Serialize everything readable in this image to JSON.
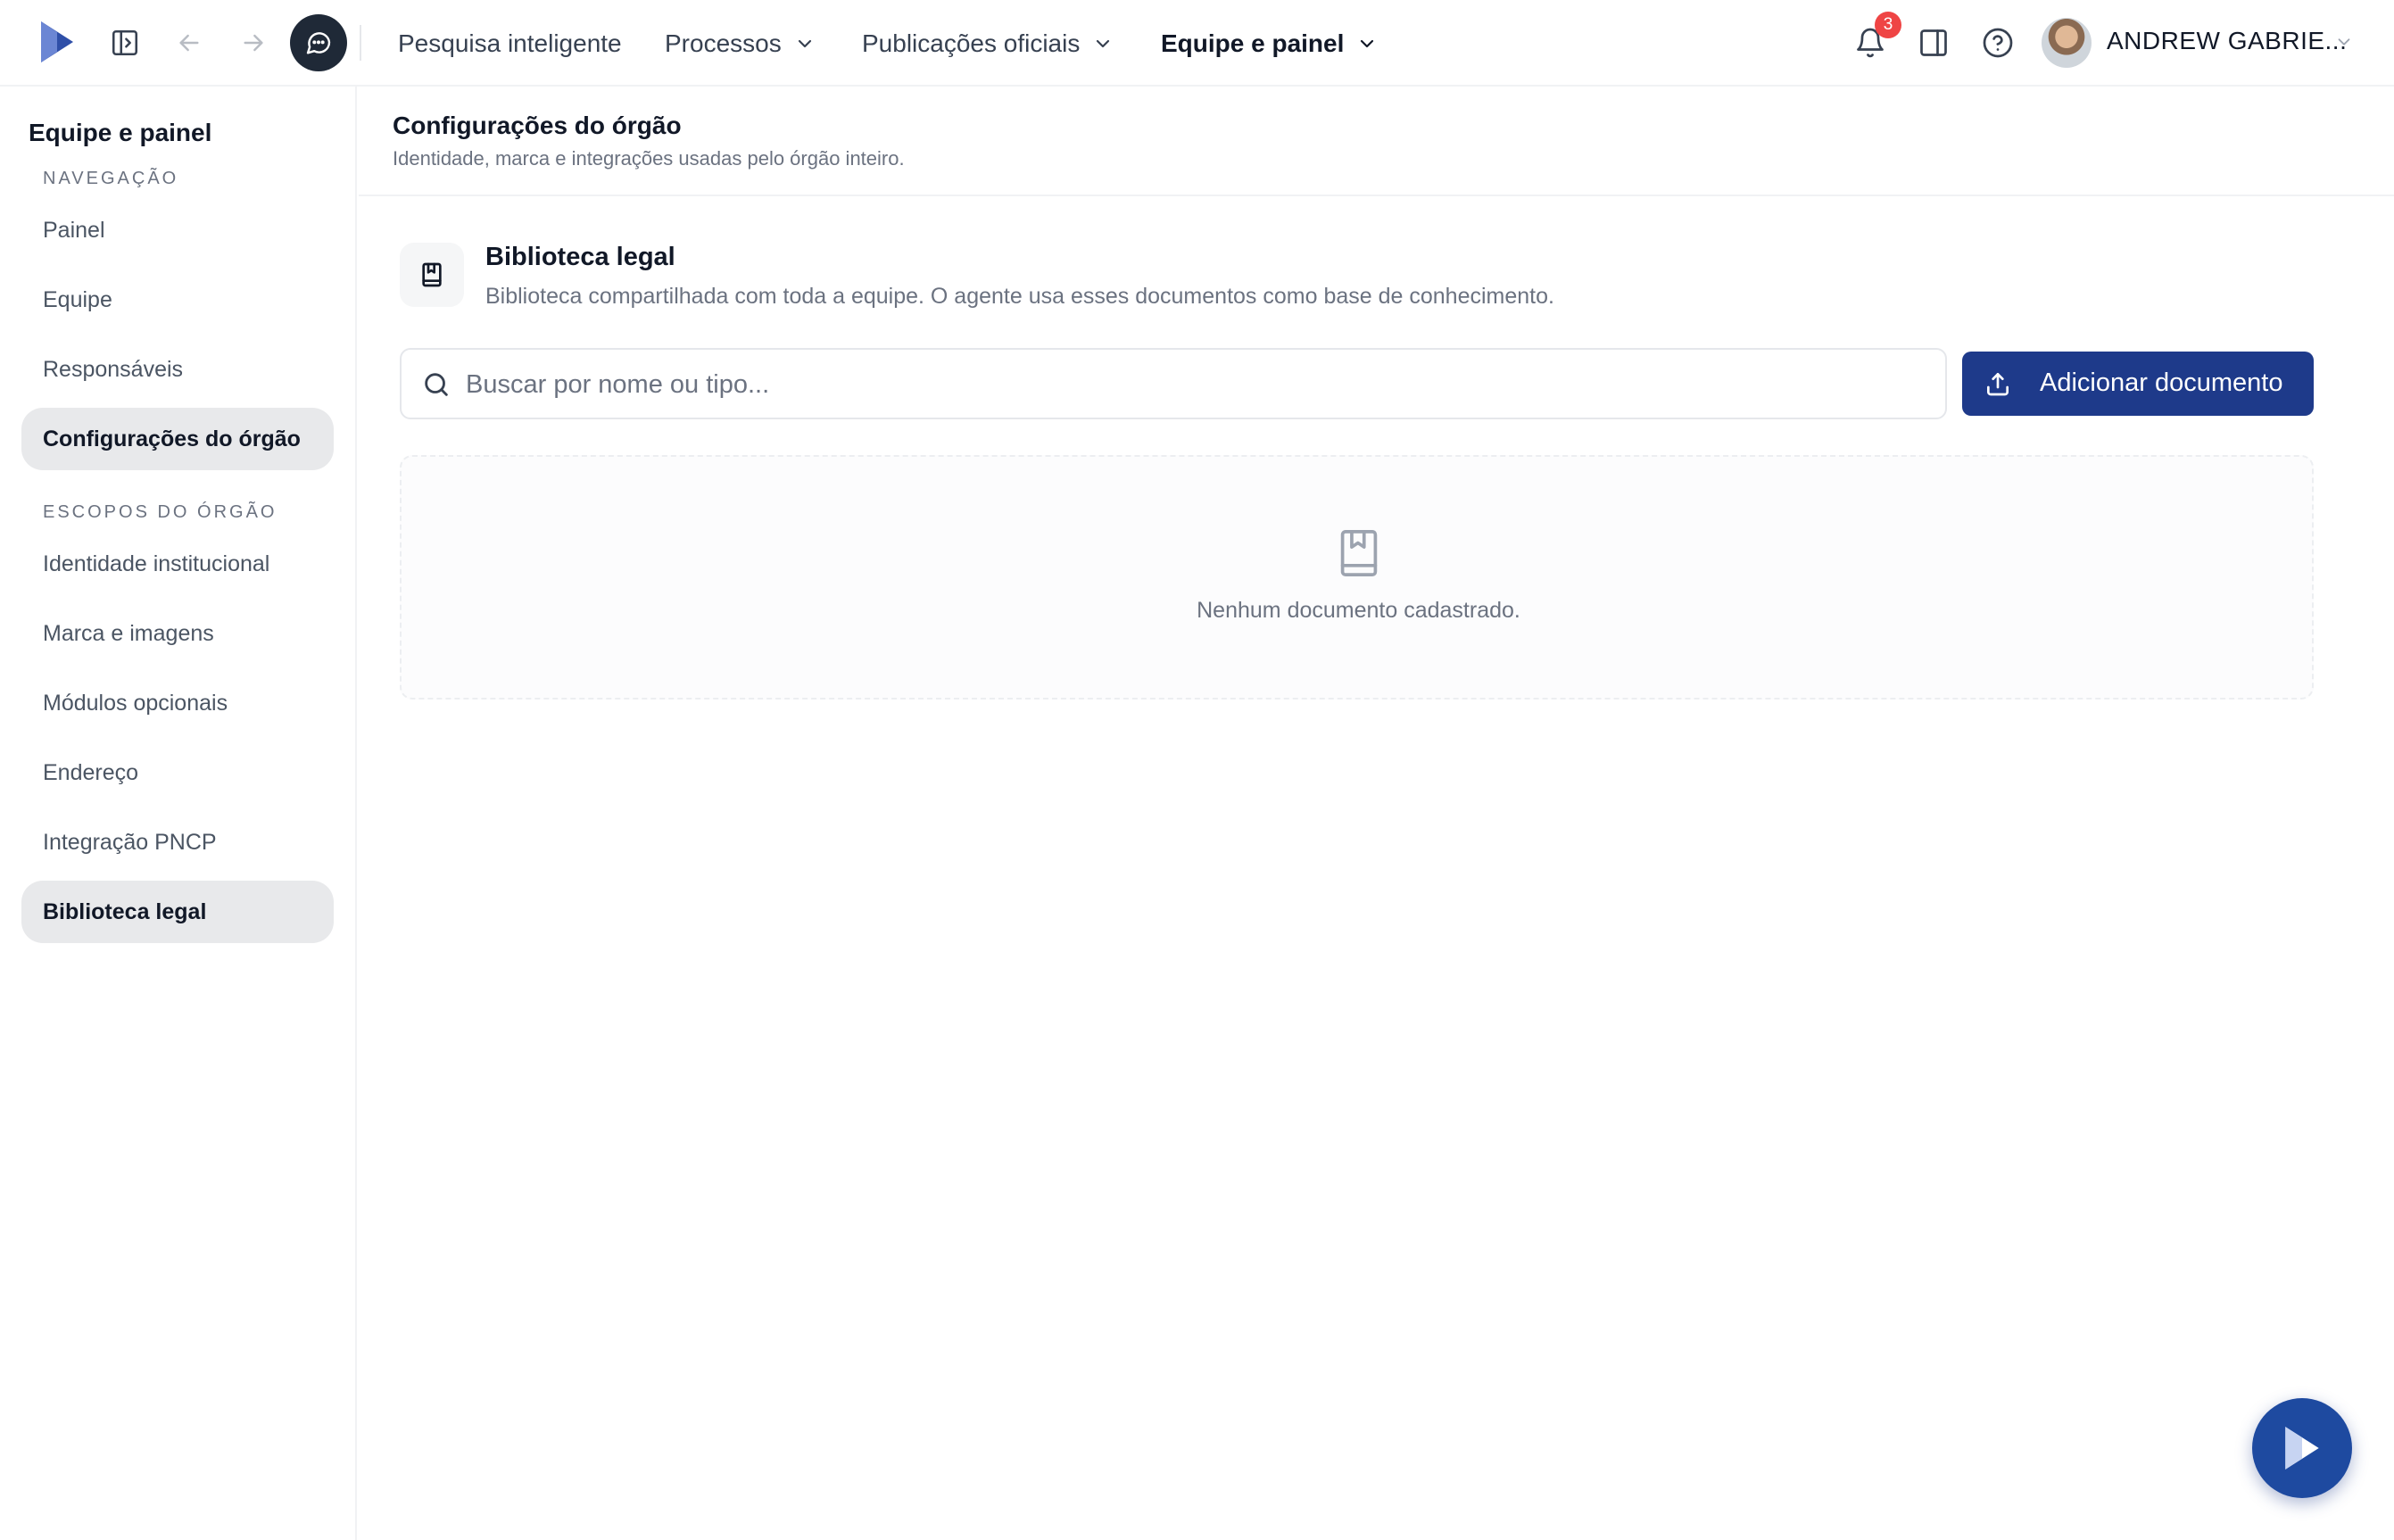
{
  "topbar": {
    "nav": [
      {
        "label": "Pesquisa inteligente",
        "has_dropdown": false
      },
      {
        "label": "Processos",
        "has_dropdown": true
      },
      {
        "label": "Publicações oficiais",
        "has_dropdown": true
      },
      {
        "label": "Equipe e painel",
        "has_dropdown": true,
        "active": true
      }
    ],
    "notifications_count": "3",
    "user_name": "ANDREW GABRIE..."
  },
  "sidebar": {
    "title": "Equipe e painel",
    "sections": [
      {
        "label": "NAVEGAÇÃO",
        "items": [
          {
            "label": "Painel"
          },
          {
            "label": "Equipe"
          },
          {
            "label": "Responsáveis"
          },
          {
            "label": "Configurações do órgão",
            "active": true
          }
        ]
      },
      {
        "label": "ESCOPOS DO ÓRGÃO",
        "items": [
          {
            "label": "Identidade institucional"
          },
          {
            "label": "Marca e imagens"
          },
          {
            "label": "Módulos opcionais"
          },
          {
            "label": "Endereço"
          },
          {
            "label": "Integração PNCP"
          },
          {
            "label": "Biblioteca legal",
            "active": true
          }
        ]
      }
    ]
  },
  "page": {
    "title": "Configurações do órgão",
    "subtitle": "Identidade, marca e integrações usadas pelo órgão inteiro."
  },
  "library": {
    "title": "Biblioteca legal",
    "description": "Biblioteca compartilhada com toda a equipe. O agente usa esses documentos como base de conhecimento.",
    "search_placeholder": "Buscar por nome ou tipo...",
    "search_value": "",
    "add_button": "Adicionar documento",
    "empty_text": "Nenhum documento cadastrado."
  },
  "colors": {
    "primary": "#1e3a8a",
    "badge": "#ef4444",
    "active_bg": "#e8e9eb"
  },
  "icons": [
    "app-logo-icon",
    "sidebar-toggle-icon",
    "back-arrow-icon",
    "forward-arrow-icon",
    "chat-icon",
    "chevron-down-icon",
    "bell-icon",
    "panel-icon",
    "help-icon",
    "book-icon",
    "search-icon",
    "upload-icon",
    "assistant-play-icon"
  ]
}
